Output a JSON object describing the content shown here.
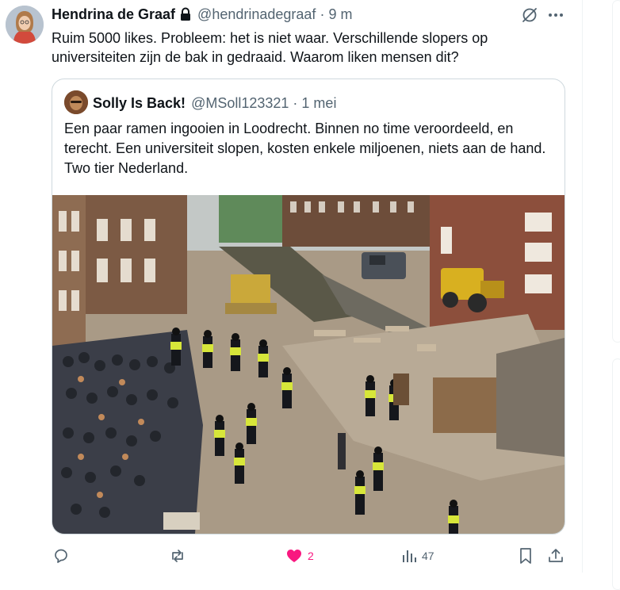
{
  "tweet": {
    "author_name": "Hendrina de Graaf",
    "author_handle": "@hendrinadegraaf",
    "separator": "·",
    "time": "9 m",
    "text": "Ruim 5000 likes. Probleem: het is niet waar. Verschillende slopers op universiteiten zijn de bak in gedraaid. Waarom liken mensen dit?",
    "icons": {
      "protected": "lock-icon",
      "grok": "grok-icon",
      "more": "more-icon"
    }
  },
  "quote": {
    "author_name": "Solly Is Back!",
    "author_handle": "@MSoll123321",
    "separator": "·",
    "time": "1 mei",
    "text": "Een paar ramen ingooien in Loodrecht. Binnen no time veroordeeld, en terecht. Een universiteit slopen, kosten enkele miljoenen, niets aan de hand. Two tier Nederland.",
    "image": "photo of riot police lines and crowd beside a canal with rubble and a yellow bulldozer"
  },
  "actions": {
    "reply": {
      "icon": "reply-icon",
      "count": ""
    },
    "repost": {
      "icon": "repost-icon",
      "count": ""
    },
    "like": {
      "icon": "heart-filled-icon",
      "count": "2",
      "active": true,
      "color": "#f91880"
    },
    "views": {
      "icon": "views-icon",
      "count": "47"
    },
    "bookmark": {
      "icon": "bookmark-icon"
    },
    "share": {
      "icon": "share-icon"
    }
  },
  "colors": {
    "text": "#0f1419",
    "secondary": "#536471",
    "border": "#cfd9de",
    "like": "#f91880"
  }
}
